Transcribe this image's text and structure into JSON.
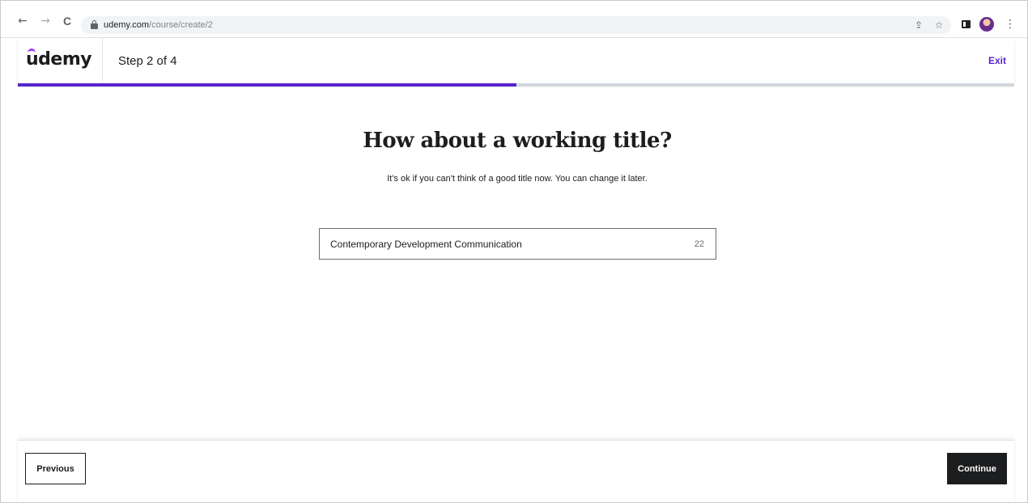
{
  "browser": {
    "back_icon": "←",
    "forward_icon": "→",
    "reload_icon": "C",
    "url_host": "udemy.com",
    "url_path": "/course/create/2",
    "share_icon": "⇪",
    "star_icon": "☆",
    "menu_icon": "⋮"
  },
  "header": {
    "logo_text": "udemy",
    "step_label": "Step 2 of 4",
    "exit_label": "Exit",
    "progress_fraction": 0.5,
    "accent_color": "#5624d0",
    "logo_color": "#a435f0"
  },
  "main": {
    "title": "How about a working title?",
    "subtitle": "It's ok if you can't think of a good title now. You can change it later.",
    "title_input_value": "Contemporary Development Communication",
    "char_count": "22"
  },
  "footer": {
    "previous_label": "Previous",
    "continue_label": "Continue"
  }
}
